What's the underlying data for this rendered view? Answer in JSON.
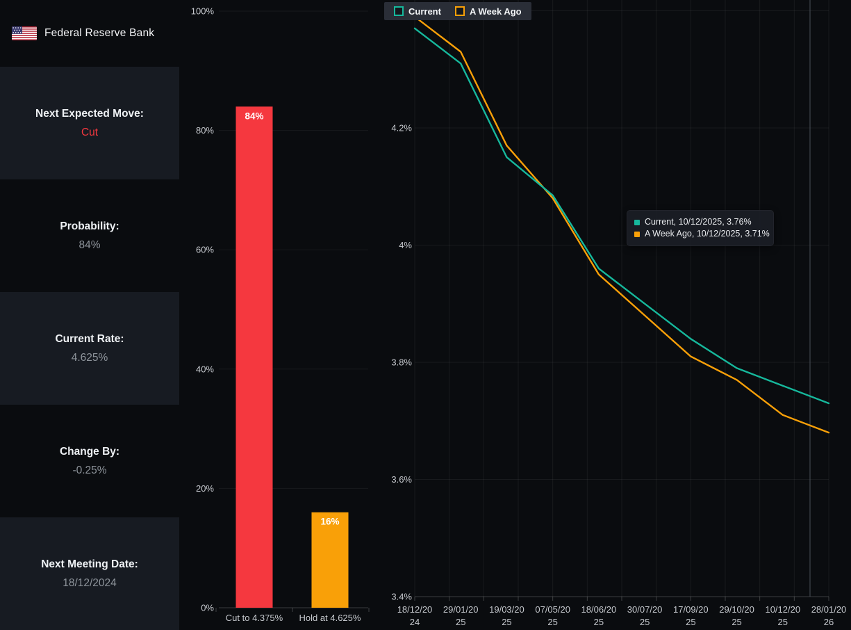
{
  "header": {
    "title": "Federal Reserve Bank",
    "flag_icon": "us-flag-icon"
  },
  "sidebar": {
    "panels": [
      {
        "label": "Next Expected Move:",
        "value": "Cut",
        "value_color": "#f5383f"
      },
      {
        "label": "Probability:",
        "value": "84%"
      },
      {
        "label": "Current Rate:",
        "value": "4.625%"
      },
      {
        "label": "Change By:",
        "value": "-0.25%"
      },
      {
        "label": "Next Meeting Date:",
        "value": "18/12/2024"
      }
    ]
  },
  "colors": {
    "red": "#f5383f",
    "orange": "#f9a008",
    "teal": "#16b89c",
    "panel_light": "#171b22",
    "background": "#0a0c0f"
  },
  "chart_data": [
    {
      "type": "bar",
      "title": "",
      "categories": [
        "Cut to 4.375%",
        "Hold at 4.625%"
      ],
      "values": [
        84,
        16
      ],
      "value_labels": [
        "84%",
        "16%"
      ],
      "bar_colors": [
        "#f5383f",
        "#f9a008"
      ],
      "xlabel": "",
      "ylabel": "",
      "ylim": [
        0,
        100
      ],
      "yticks": [
        0,
        20,
        40,
        60,
        80,
        100
      ],
      "ytick_labels": [
        "0%",
        "20%",
        "40%",
        "60%",
        "80%",
        "100%"
      ],
      "grid": true,
      "legend_position": "none"
    },
    {
      "type": "line",
      "title": "",
      "categories": [
        "18/12/2024",
        "29/01/2025",
        "19/03/2025",
        "07/05/2025",
        "18/06/2025",
        "30/07/2025",
        "17/09/2025",
        "29/10/2025",
        "10/12/2025",
        "28/01/2026"
      ],
      "x_tick_labels": [
        [
          "18/12/20",
          "24"
        ],
        [
          "29/01/20",
          "25"
        ],
        [
          "19/03/20",
          "25"
        ],
        [
          "07/05/20",
          "25"
        ],
        [
          "18/06/20",
          "25"
        ],
        [
          "30/07/20",
          "25"
        ],
        [
          "17/09/20",
          "25"
        ],
        [
          "29/10/20",
          "25"
        ],
        [
          "10/12/20",
          "25"
        ],
        [
          "28/01/20",
          "26"
        ]
      ],
      "series": [
        {
          "name": "Current",
          "color": "#16b89c",
          "values": [
            4.37,
            4.31,
            4.15,
            4.085,
            3.96,
            3.9,
            3.84,
            3.79,
            3.76,
            3.73
          ]
        },
        {
          "name": "A Week Ago",
          "color": "#f9a008",
          "values": [
            4.39,
            4.33,
            4.17,
            4.08,
            3.95,
            3.88,
            3.81,
            3.77,
            3.71,
            3.68
          ]
        }
      ],
      "xlabel": "",
      "ylabel": "",
      "ylim": [
        3.4,
        4.4
      ],
      "yticks": [
        3.4,
        3.6,
        3.8,
        4.0,
        4.2,
        4.4
      ],
      "ytick_labels": [
        "3.4%",
        "3.6%",
        "3.8%",
        "4%",
        "4.2%",
        ""
      ],
      "grid": true,
      "legend_position": "top-left"
    }
  ],
  "legend": {
    "items": [
      {
        "label": "Current",
        "color": "#16b89c"
      },
      {
        "label": "A Week Ago",
        "color": "#f9a008"
      }
    ]
  },
  "tooltip": {
    "rows": [
      {
        "color": "#16b89c",
        "text": "Current, 10/12/2025, 3.76%"
      },
      {
        "color": "#f9a008",
        "text": "A Week Ago, 10/12/2025, 3.71%"
      }
    ]
  }
}
